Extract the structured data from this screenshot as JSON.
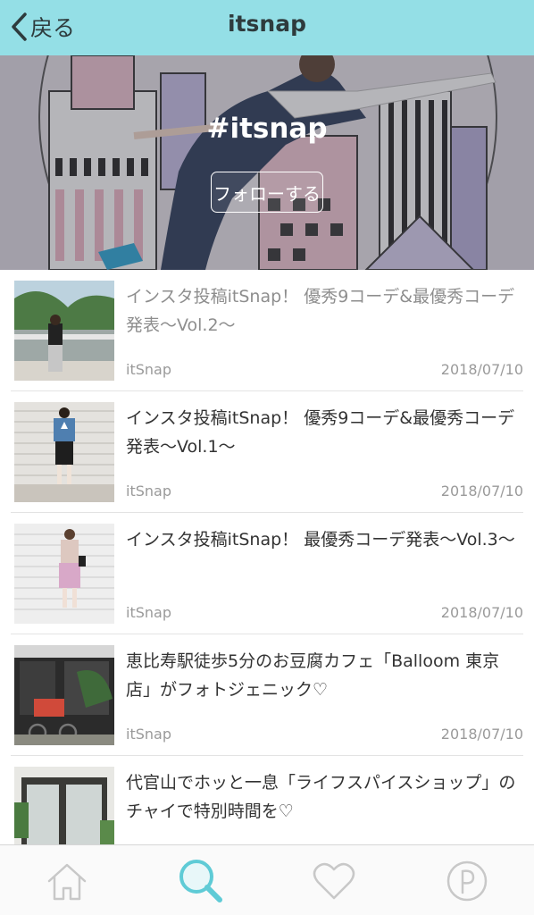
{
  "navbar": {
    "back_label": "戻る",
    "title": "itsnap"
  },
  "hero": {
    "tag": "#itsnap",
    "follow_label": "フォローする"
  },
  "articles": [
    {
      "title": "インスタ投稿itSnap！ 優秀9コーデ&最優秀コーデ発表〜Vol.2〜",
      "source": "itSnap",
      "date": "2018/07/10",
      "read": true
    },
    {
      "title": "インスタ投稿itSnap！ 優秀9コーデ&最優秀コーデ発表〜Vol.1〜",
      "source": "itSnap",
      "date": "2018/07/10",
      "read": false
    },
    {
      "title": "インスタ投稿itSnap！ 最優秀コーデ発表〜Vol.3〜",
      "source": "itSnap",
      "date": "2018/07/10",
      "read": false
    },
    {
      "title": "恵比寿駅徒歩5分のお豆腐カフェ「Balloom 東京店」がフォトジェニック♡",
      "source": "itSnap",
      "date": "2018/07/10",
      "read": false
    },
    {
      "title": "代官山でホッと一息「ライフスパイスショップ」のチャイで特別時間を♡",
      "source": "",
      "date": "",
      "read": false
    }
  ],
  "tabbar": {
    "items": [
      "home-icon",
      "search-icon",
      "heart-icon",
      "p-icon"
    ],
    "active": "search-icon",
    "active_color": "#5fcbd6",
    "inactive_color": "#c8c8c8"
  }
}
